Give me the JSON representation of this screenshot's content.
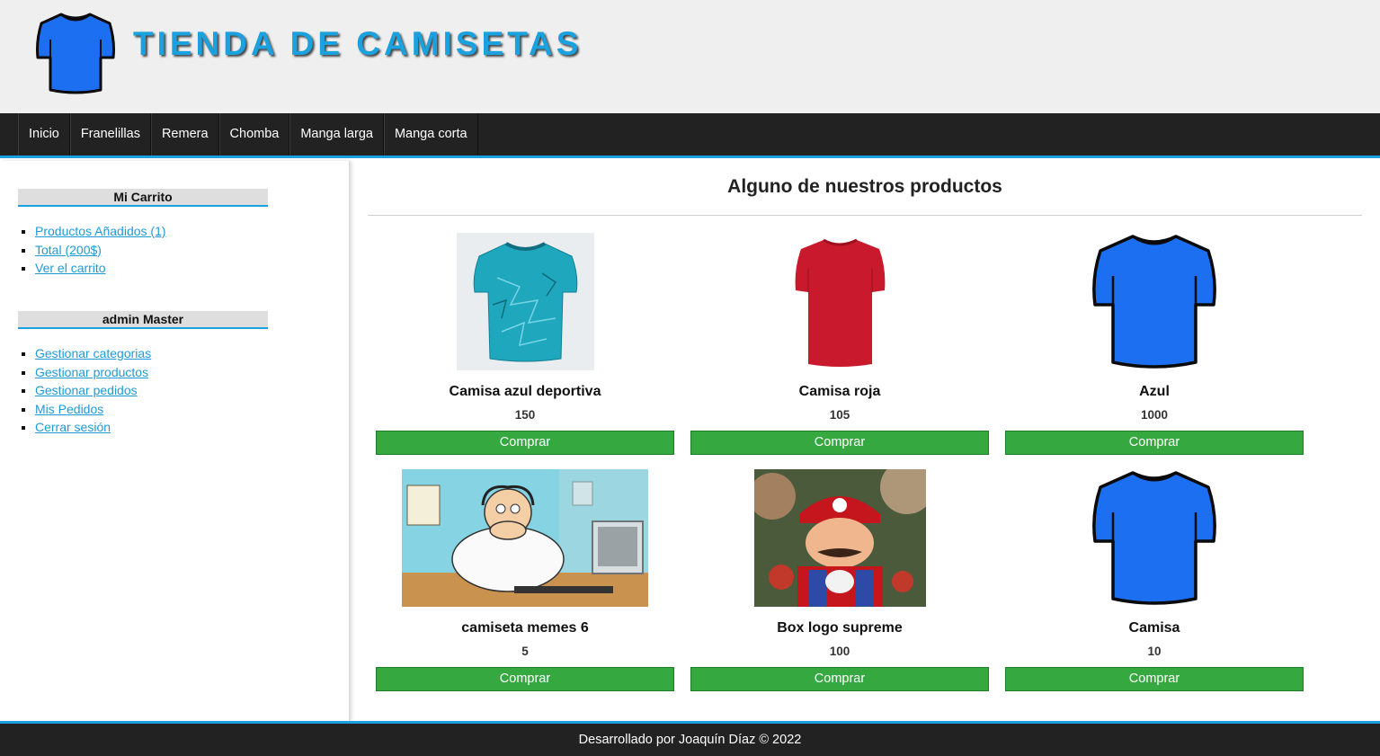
{
  "header": {
    "site_title": "TIENDA DE CAMISETAS",
    "logo_icon": "blue-tshirt-icon"
  },
  "menu": {
    "items": [
      {
        "label": "Inicio"
      },
      {
        "label": "Franelillas"
      },
      {
        "label": "Remera"
      },
      {
        "label": "Chomba"
      },
      {
        "label": "Manga larga"
      },
      {
        "label": "Manga corta"
      }
    ]
  },
  "sidebar": {
    "cart": {
      "title": "Mi Carrito",
      "links": [
        "Productos Añadidos (1)",
        "Total (200$)",
        "Ver el carrito"
      ]
    },
    "admin": {
      "title": "admin Master",
      "links": [
        "Gestionar categorias",
        "Gestionar productos",
        "Gestionar pedidos",
        "Mis Pedidos",
        "Cerrar sesión"
      ]
    }
  },
  "content": {
    "title": "Alguno de nuestros productos",
    "products": [
      {
        "name": "Camisa azul deportiva",
        "price": "150",
        "button": "Comprar",
        "image": "teal-sport-jersey"
      },
      {
        "name": "Camisa roja",
        "price": "105",
        "button": "Comprar",
        "image": "red-tshirt"
      },
      {
        "name": "Azul",
        "price": "1000",
        "button": "Comprar",
        "image": "blue-tshirt"
      },
      {
        "name": "camiseta memes 6",
        "price": "5",
        "button": "Comprar",
        "image": "cartoon-office-meme"
      },
      {
        "name": "Box logo supreme",
        "price": "100",
        "button": "Comprar",
        "image": "plumber-character-photo"
      },
      {
        "name": "Camisa",
        "price": "10",
        "button": "Comprar",
        "image": "blue-tshirt"
      }
    ]
  },
  "footer": {
    "text": "Desarrollado por Joaquín Díaz © 2022"
  },
  "colors": {
    "accent": "#1aa1de",
    "dark_bar": "#222222",
    "buy_button": "#35a93f",
    "header_bg": "#efefef",
    "shirt_blue": "#1d6ff2"
  }
}
